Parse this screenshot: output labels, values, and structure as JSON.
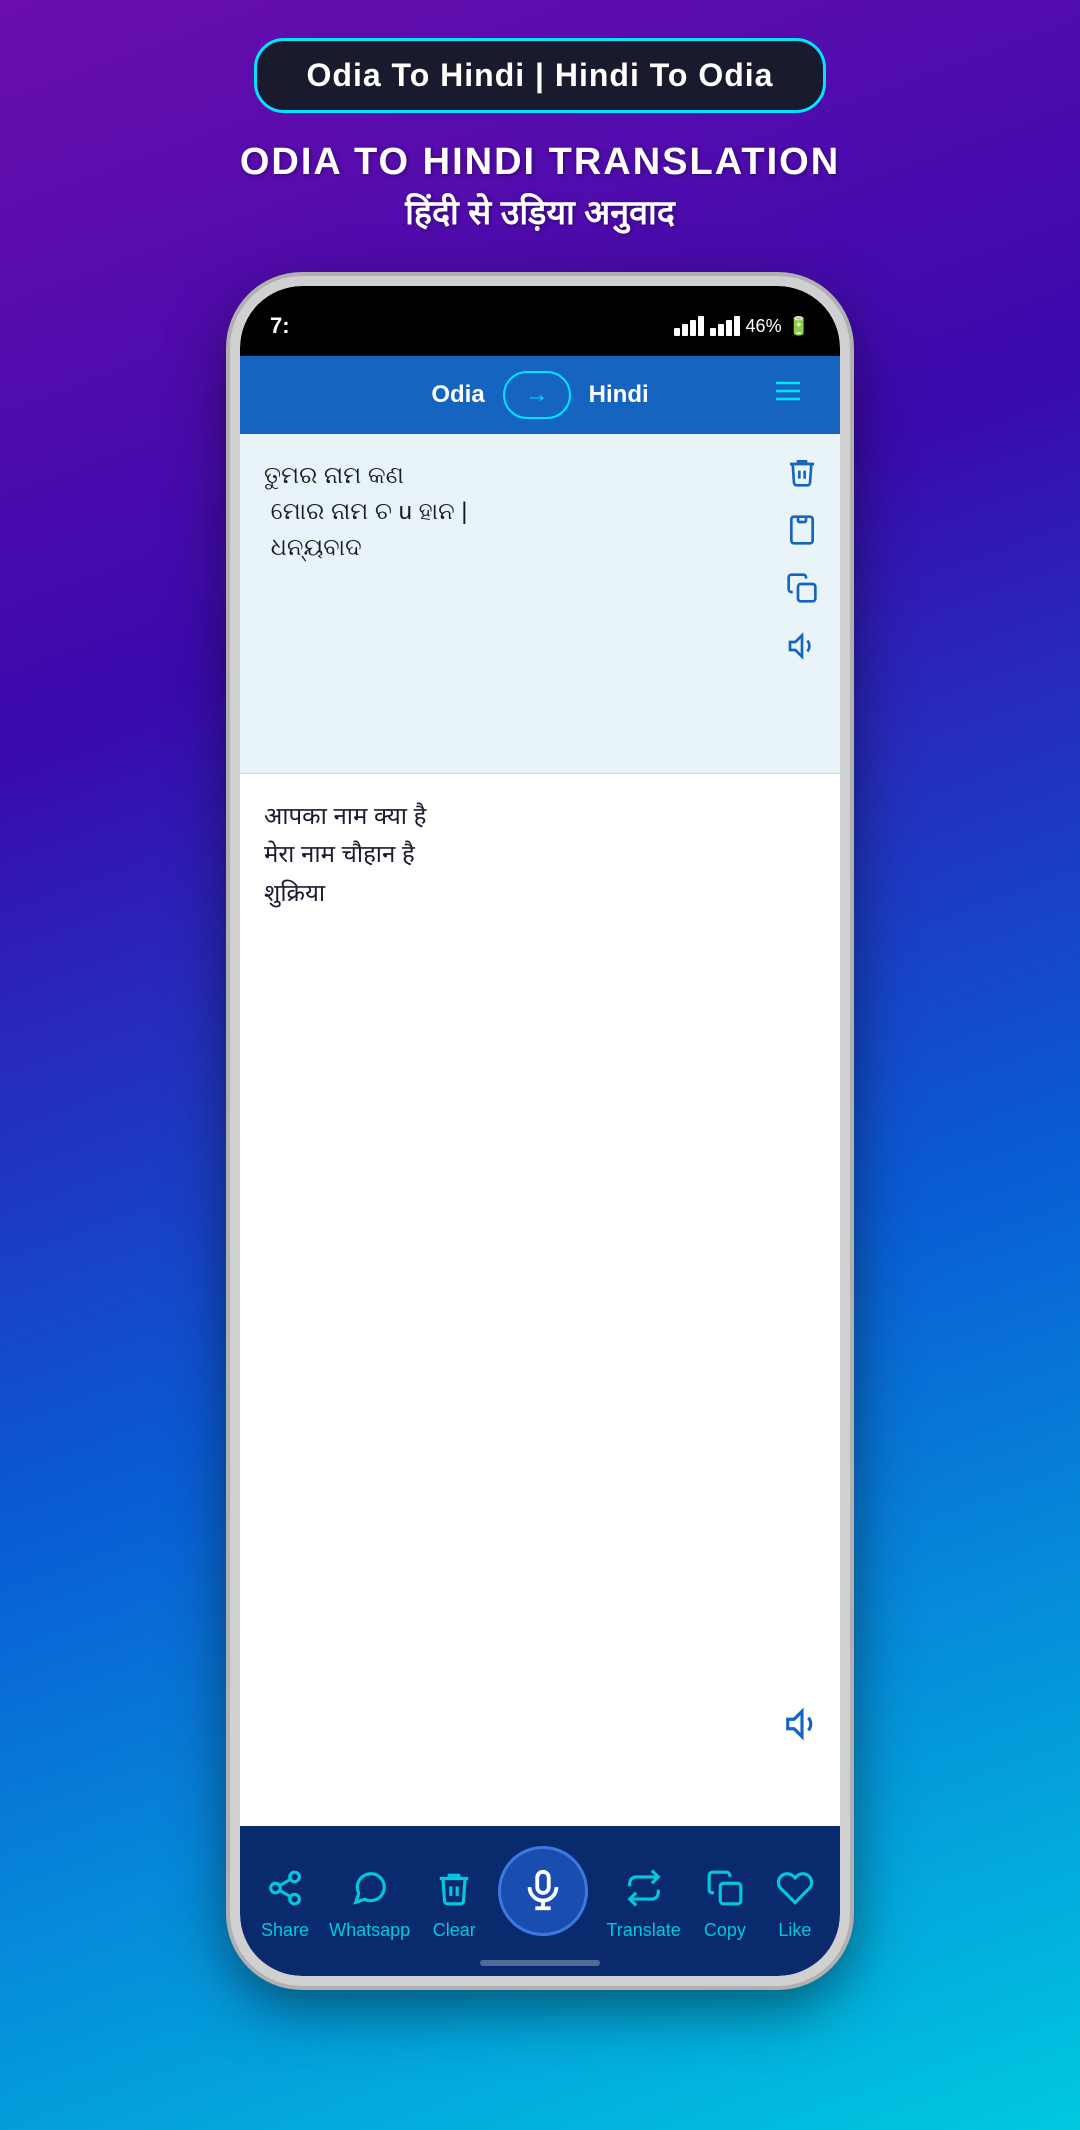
{
  "appTitleBar": {
    "text": "Odia To Hindi | Hindi To Odia"
  },
  "heading": {
    "line1": "ODIA TO HINDI TRANSLATION",
    "line2": "हिंदी से उड़िया अनुवाद"
  },
  "statusBar": {
    "time": "7:",
    "battery": "46%"
  },
  "appNav": {
    "sourceLang": "Odia",
    "targetLang": "Hindi"
  },
  "inputSection": {
    "text": "ତୁମର ନାମ କଣ\n ମୋର ନାମ ଚ u ହାନ |\n ଧନ୍ୟବାଦ"
  },
  "outputSection": {
    "text": "आपका नाम क्या है\nमेरा नाम चौहान है\nशुक्रिया"
  },
  "bottomBar": {
    "share": "Share",
    "whatsapp": "Whatsapp",
    "clear": "Clear",
    "translate": "Translate",
    "copy": "Copy",
    "like": "Like"
  }
}
